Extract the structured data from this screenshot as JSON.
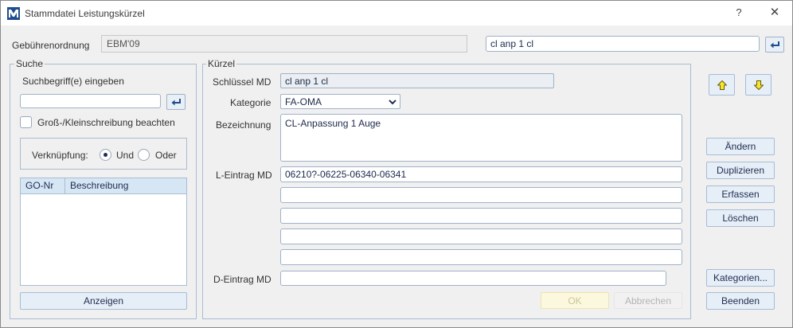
{
  "window": {
    "title": "Stammdatei Leistungskürzel",
    "help_glyph": "?",
    "close_glyph": "✕"
  },
  "header": {
    "gebuehrenordnung_label": "Gebührenordnung",
    "gebuehrenordnung_value": "EBM'09",
    "search_value": "cl anp 1 cl"
  },
  "suche": {
    "legend": "Suche",
    "prompt": "Suchbegriff(e) eingeben",
    "input_value": "",
    "case_sensitive_label": "Groß-/Kleinschreibung beachten",
    "case_sensitive_checked": false,
    "verknuepfung_label": "Verknüpfung:",
    "options": [
      {
        "label": "Und",
        "selected": true
      },
      {
        "label": "Oder",
        "selected": false
      }
    ],
    "columns": [
      "GO-Nr",
      "Beschreibung"
    ],
    "rows": [],
    "show_button": "Anzeigen"
  },
  "kuerzel": {
    "legend": "Kürzel",
    "schluessel_label": "Schlüssel MD",
    "schluessel_value": "cl anp 1 cl",
    "kategorie_label": "Kategorie",
    "kategorie_value": "FA-OMA",
    "bezeichnung_label": "Bezeichnung",
    "bezeichnung_value": "CL-Anpassung 1 Auge",
    "l_eintrag_label": "L-Eintrag MD",
    "l_eintrag_values": [
      "06210?-06225-06340-06341",
      "",
      "",
      "",
      ""
    ],
    "d_eintrag_label": "D-Eintrag MD",
    "d_eintrag_value": "",
    "ok_button": "OK",
    "cancel_button": "Abbrechen"
  },
  "actions": {
    "up_icon": "arrow-up-icon",
    "down_icon": "arrow-down-icon",
    "buttons": [
      "Ändern",
      "Duplizieren",
      "Erfassen",
      "Löschen"
    ],
    "kategorien_button": "Kategorien...",
    "beenden_button": "Beenden"
  },
  "colors": {
    "accent_blue": "#1f4e8c",
    "arrow_yellow": "#f7e72a",
    "button_bg": "#e6eef8"
  }
}
